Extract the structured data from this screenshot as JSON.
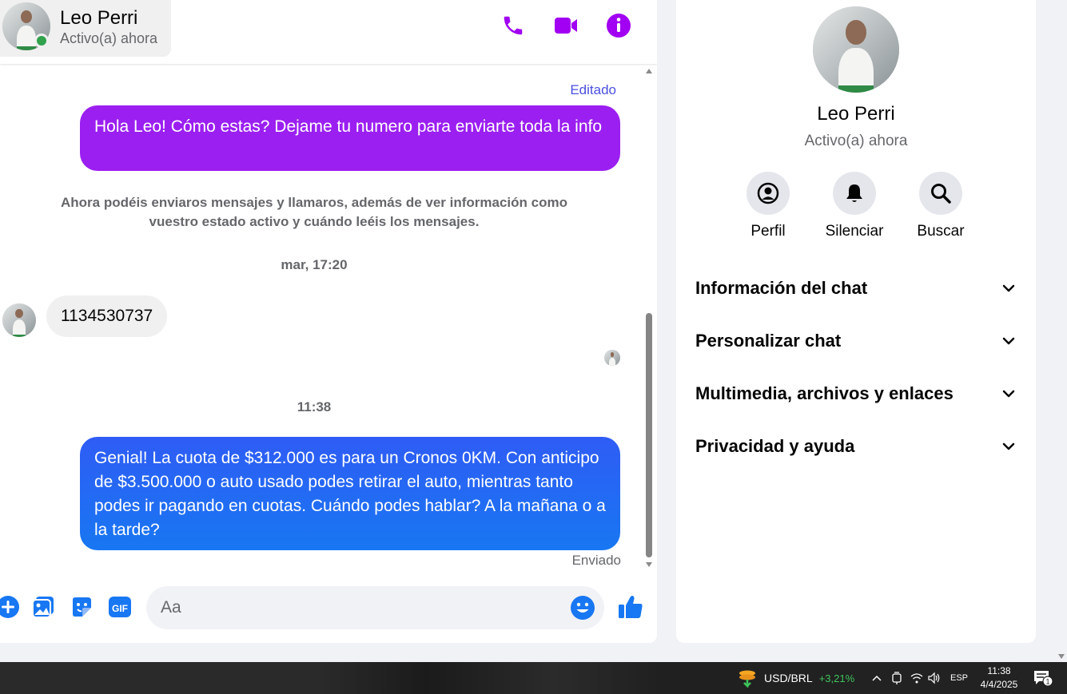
{
  "header": {
    "contact_name": "Leo Perri",
    "contact_status": "Activo(a) ahora",
    "icons": [
      "phone-icon",
      "video-camera-icon",
      "info-icon"
    ]
  },
  "conversation": {
    "edited_label": "Editado",
    "msg_outgoing_1": "Hola Leo! Cómo estas? Dejame tu numero para enviarte toda la info",
    "system_note": "Ahora podéis enviaros mensajes y llamaros, además de ver información como vuestro estado activo y cuándo leéis los mensajes.",
    "timestamp_1": "mar, 17:20",
    "msg_incoming_1": "1134530737",
    "timestamp_2": "11:38",
    "msg_outgoing_2": "Genial! La cuota de $312.000 es para un Cronos 0KM. Con anticipo de $3.500.000 o auto usado podes retirar el auto, mientras tanto podes ir pagando en cuotas. Cuándo podes hablar? A la mañana o a la tarde?",
    "sent_label": "Enviado"
  },
  "composer": {
    "placeholder": "Aa",
    "icons": [
      "plus-icon",
      "image-icon",
      "sticker-icon",
      "gif-icon",
      "emoji-icon",
      "thumbs-up-icon"
    ],
    "gif_label": "GIF"
  },
  "info_panel": {
    "name": "Leo Perri",
    "status": "Activo(a) ahora",
    "actions": [
      {
        "label": "Perfil",
        "icon": "profile-icon"
      },
      {
        "label": "Silenciar",
        "icon": "bell-icon"
      },
      {
        "label": "Buscar",
        "icon": "search-icon"
      }
    ],
    "sections": [
      {
        "label": "Información del chat"
      },
      {
        "label": "Personalizar chat"
      },
      {
        "label": "Multimedia, archivos y enlaces"
      },
      {
        "label": "Privacidad y ayuda"
      }
    ]
  },
  "taskbar": {
    "ticker_name": "USD/BRL",
    "ticker_change": "+3,21%",
    "language": "ESP",
    "time": "11:38",
    "date": "4/4/2025",
    "notification_count": "1"
  },
  "colors": {
    "accent_purple": "#a100f2",
    "bubble_purple": "#9b1ff0",
    "bubble_blue": "#1877f2",
    "online_green": "#31a24c",
    "ticker_green": "#3ec35a"
  }
}
